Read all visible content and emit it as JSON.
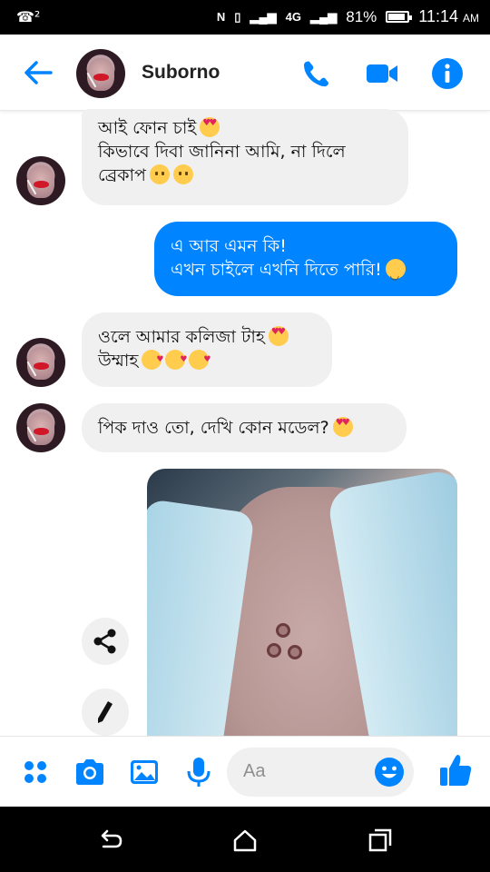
{
  "status_bar": {
    "left_indicator": "☎²",
    "icons": [
      "nfc-icon",
      "vibrate-icon",
      "signal-icon",
      "4g-icon",
      "signal-icon"
    ],
    "network": "4G",
    "battery_text": "81%",
    "battery_level": 0.81,
    "time": "11:14",
    "ampm": "AM"
  },
  "header": {
    "contact_name": "Suborno",
    "accent_color": "#0084ff"
  },
  "messages": [
    {
      "from": "them",
      "lines": [
        "আই ফোন চাই",
        "কিভাবে দিবা জানিনা আমি, না দিলে",
        "ব্রেকাপ"
      ],
      "emoji": [
        "heart-eyes-emoji",
        "sad-emoji",
        "sad-emoji"
      ]
    },
    {
      "from": "me",
      "lines": [
        "এ আর এমন কি!",
        "এখন চাইলে এখনি দিতে পারি!"
      ],
      "emoji": [
        "smile-emoji"
      ]
    },
    {
      "from": "them",
      "lines": [
        "ওলে আমার কলিজা টাহ",
        "উম্মাহ"
      ],
      "emoji": [
        "heart-eyes-emoji",
        "kiss-emoji",
        "kiss-emoji",
        "kiss-emoji"
      ]
    },
    {
      "from": "them",
      "lines": [
        "পিক দাও তো, দেখি কোন মডেল?"
      ],
      "emoji": [
        "heart-eyes-emoji"
      ]
    }
  ],
  "photo_actions": [
    "share-icon",
    "edit-icon"
  ],
  "composer": {
    "placeholder": "Aa",
    "buttons": [
      "more-icon",
      "camera-icon",
      "gallery-icon",
      "mic-icon",
      "emoji-icon",
      "like-icon"
    ]
  },
  "nav_bar": [
    "back-icon",
    "home-icon",
    "recents-icon"
  ]
}
